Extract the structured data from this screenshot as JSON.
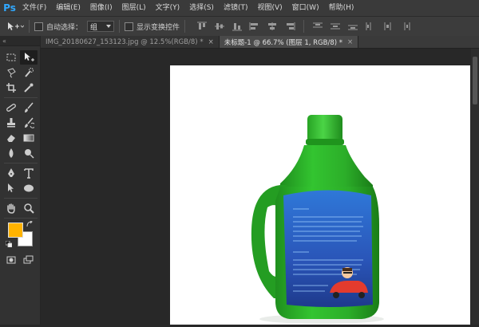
{
  "app": {
    "logo": "Ps"
  },
  "menu": [
    "文件(F)",
    "编辑(E)",
    "图像(I)",
    "图层(L)",
    "文字(Y)",
    "选择(S)",
    "滤镜(T)",
    "视图(V)",
    "窗口(W)",
    "帮助(H)"
  ],
  "options": {
    "auto_select_label": "自动选择：",
    "auto_select_value": "组",
    "transform_controls_label": "显示变换控件"
  },
  "tabs": [
    {
      "label": "IMG_20180627_153123.jpg @ 12.5%(RGB/8) *",
      "close": "×"
    },
    {
      "label": "未标题-1 @ 66.7% (图层 1, RGB/8) *",
      "close": "×"
    }
  ],
  "colors": {
    "foreground": "#ffb300",
    "background": "#ffffff",
    "bottle_green": "#2db52b",
    "label_blue": "#2a5fc4"
  },
  "tools": [
    "move-tool",
    "marquee-tool",
    "lasso-tool",
    "magic-wand-tool",
    "crop-tool",
    "eyedropper-tool",
    "healing-brush-tool",
    "brush-tool",
    "clone-stamp-tool",
    "history-brush-tool",
    "eraser-tool",
    "gradient-tool",
    "blur-tool",
    "dodge-tool",
    "pen-tool",
    "type-tool",
    "path-selection-tool",
    "shape-tool",
    "hand-tool",
    "zoom-tool"
  ]
}
